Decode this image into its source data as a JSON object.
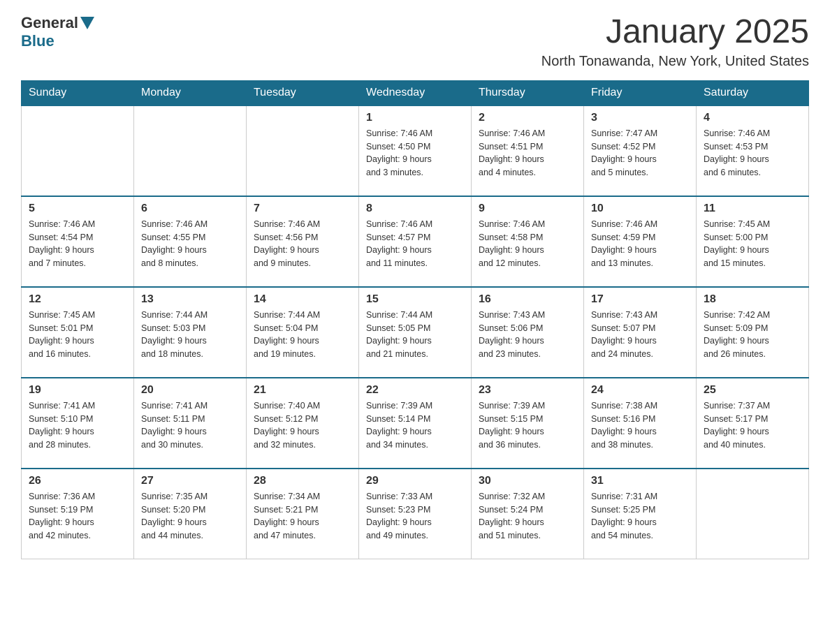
{
  "logo": {
    "general": "General",
    "blue": "Blue"
  },
  "title": "January 2025",
  "location": "North Tonawanda, New York, United States",
  "days_of_week": [
    "Sunday",
    "Monday",
    "Tuesday",
    "Wednesday",
    "Thursday",
    "Friday",
    "Saturday"
  ],
  "weeks": [
    [
      {
        "day": "",
        "info": ""
      },
      {
        "day": "",
        "info": ""
      },
      {
        "day": "",
        "info": ""
      },
      {
        "day": "1",
        "info": "Sunrise: 7:46 AM\nSunset: 4:50 PM\nDaylight: 9 hours\nand 3 minutes."
      },
      {
        "day": "2",
        "info": "Sunrise: 7:46 AM\nSunset: 4:51 PM\nDaylight: 9 hours\nand 4 minutes."
      },
      {
        "day": "3",
        "info": "Sunrise: 7:47 AM\nSunset: 4:52 PM\nDaylight: 9 hours\nand 5 minutes."
      },
      {
        "day": "4",
        "info": "Sunrise: 7:46 AM\nSunset: 4:53 PM\nDaylight: 9 hours\nand 6 minutes."
      }
    ],
    [
      {
        "day": "5",
        "info": "Sunrise: 7:46 AM\nSunset: 4:54 PM\nDaylight: 9 hours\nand 7 minutes."
      },
      {
        "day": "6",
        "info": "Sunrise: 7:46 AM\nSunset: 4:55 PM\nDaylight: 9 hours\nand 8 minutes."
      },
      {
        "day": "7",
        "info": "Sunrise: 7:46 AM\nSunset: 4:56 PM\nDaylight: 9 hours\nand 9 minutes."
      },
      {
        "day": "8",
        "info": "Sunrise: 7:46 AM\nSunset: 4:57 PM\nDaylight: 9 hours\nand 11 minutes."
      },
      {
        "day": "9",
        "info": "Sunrise: 7:46 AM\nSunset: 4:58 PM\nDaylight: 9 hours\nand 12 minutes."
      },
      {
        "day": "10",
        "info": "Sunrise: 7:46 AM\nSunset: 4:59 PM\nDaylight: 9 hours\nand 13 minutes."
      },
      {
        "day": "11",
        "info": "Sunrise: 7:45 AM\nSunset: 5:00 PM\nDaylight: 9 hours\nand 15 minutes."
      }
    ],
    [
      {
        "day": "12",
        "info": "Sunrise: 7:45 AM\nSunset: 5:01 PM\nDaylight: 9 hours\nand 16 minutes."
      },
      {
        "day": "13",
        "info": "Sunrise: 7:44 AM\nSunset: 5:03 PM\nDaylight: 9 hours\nand 18 minutes."
      },
      {
        "day": "14",
        "info": "Sunrise: 7:44 AM\nSunset: 5:04 PM\nDaylight: 9 hours\nand 19 minutes."
      },
      {
        "day": "15",
        "info": "Sunrise: 7:44 AM\nSunset: 5:05 PM\nDaylight: 9 hours\nand 21 minutes."
      },
      {
        "day": "16",
        "info": "Sunrise: 7:43 AM\nSunset: 5:06 PM\nDaylight: 9 hours\nand 23 minutes."
      },
      {
        "day": "17",
        "info": "Sunrise: 7:43 AM\nSunset: 5:07 PM\nDaylight: 9 hours\nand 24 minutes."
      },
      {
        "day": "18",
        "info": "Sunrise: 7:42 AM\nSunset: 5:09 PM\nDaylight: 9 hours\nand 26 minutes."
      }
    ],
    [
      {
        "day": "19",
        "info": "Sunrise: 7:41 AM\nSunset: 5:10 PM\nDaylight: 9 hours\nand 28 minutes."
      },
      {
        "day": "20",
        "info": "Sunrise: 7:41 AM\nSunset: 5:11 PM\nDaylight: 9 hours\nand 30 minutes."
      },
      {
        "day": "21",
        "info": "Sunrise: 7:40 AM\nSunset: 5:12 PM\nDaylight: 9 hours\nand 32 minutes."
      },
      {
        "day": "22",
        "info": "Sunrise: 7:39 AM\nSunset: 5:14 PM\nDaylight: 9 hours\nand 34 minutes."
      },
      {
        "day": "23",
        "info": "Sunrise: 7:39 AM\nSunset: 5:15 PM\nDaylight: 9 hours\nand 36 minutes."
      },
      {
        "day": "24",
        "info": "Sunrise: 7:38 AM\nSunset: 5:16 PM\nDaylight: 9 hours\nand 38 minutes."
      },
      {
        "day": "25",
        "info": "Sunrise: 7:37 AM\nSunset: 5:17 PM\nDaylight: 9 hours\nand 40 minutes."
      }
    ],
    [
      {
        "day": "26",
        "info": "Sunrise: 7:36 AM\nSunset: 5:19 PM\nDaylight: 9 hours\nand 42 minutes."
      },
      {
        "day": "27",
        "info": "Sunrise: 7:35 AM\nSunset: 5:20 PM\nDaylight: 9 hours\nand 44 minutes."
      },
      {
        "day": "28",
        "info": "Sunrise: 7:34 AM\nSunset: 5:21 PM\nDaylight: 9 hours\nand 47 minutes."
      },
      {
        "day": "29",
        "info": "Sunrise: 7:33 AM\nSunset: 5:23 PM\nDaylight: 9 hours\nand 49 minutes."
      },
      {
        "day": "30",
        "info": "Sunrise: 7:32 AM\nSunset: 5:24 PM\nDaylight: 9 hours\nand 51 minutes."
      },
      {
        "day": "31",
        "info": "Sunrise: 7:31 AM\nSunset: 5:25 PM\nDaylight: 9 hours\nand 54 minutes."
      },
      {
        "day": "",
        "info": ""
      }
    ]
  ]
}
